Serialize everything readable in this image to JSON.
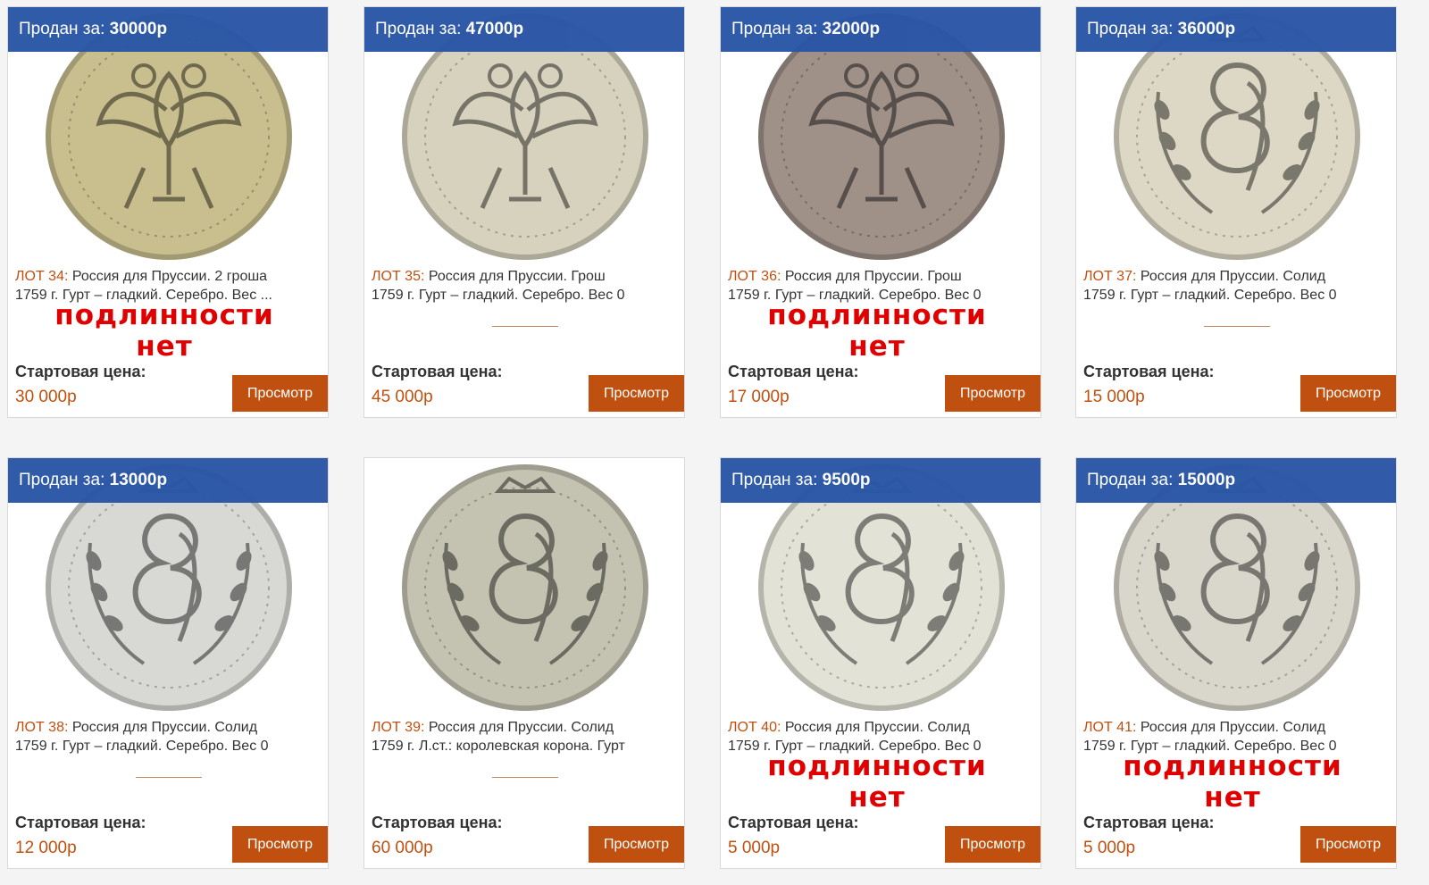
{
  "common": {
    "sold_prefix": "Продан за: ",
    "start_label": "Стартовая цена:",
    "view_button": "Просмотр",
    "stamp_line1": "подлинности",
    "stamp_line2": "нет"
  },
  "lots": [
    {
      "sold": "30000р",
      "lot": "ЛОТ 34:",
      "title": "Россия для Пруссии. 2 гроша",
      "line2": "1759 г. Гурт – гладкий. Серебро. Вес ...",
      "price": "30 000р",
      "stamp": true,
      "coin": "eagle-coin-icon",
      "tone": "#c9bf8e"
    },
    {
      "sold": "47000р",
      "lot": "ЛОТ 35:",
      "title": "Россия для Пруссии. Грош",
      "line2": "1759 г. Гурт – гладкий. Серебро. Вес 0",
      "price": "45 000р",
      "stamp": false,
      "coin": "eagle-coin-icon",
      "tone": "#d6d2bd"
    },
    {
      "sold": "32000р",
      "lot": "ЛОТ 36:",
      "title": "Россия для Пруссии. Грош",
      "line2": "1759 г. Гурт – гладкий. Серебро. Вес 0",
      "price": "17 000р",
      "stamp": true,
      "coin": "eagle-coin-icon",
      "tone": "#9f9088"
    },
    {
      "sold": "36000р",
      "lot": "ЛОТ 37:",
      "title": "Россия для Пруссии. Солид",
      "line2": "1759 г. Гурт – гладкий. Серебро. Вес 0",
      "price": "15 000р",
      "stamp": false,
      "coin": "monogram-coin-icon",
      "tone": "#ddd8c6"
    },
    {
      "sold": "13000р",
      "lot": "ЛОТ 38:",
      "title": "Россия для Пруссии. Солид",
      "line2": "1759 г. Гурт – гладкий. Серебро. Вес 0",
      "price": "12 000р",
      "stamp": false,
      "coin": "monogram-coin-icon",
      "tone": "#d8d8d4"
    },
    {
      "sold": "",
      "lot": "ЛОТ 39:",
      "title": "Россия для Пруссии. Солид",
      "line2": "1759 г. Л.ст.: королевская корона. Гурт",
      "price": "60 000р",
      "stamp": false,
      "coin": "monogram-coin-icon",
      "tone": "#c4c3b2"
    },
    {
      "sold": "9500р",
      "lot": "ЛОТ 40:",
      "title": "Россия для Пруссии. Солид",
      "line2": "1759 г. Гурт – гладкий. Серебро. Вес 0",
      "price": "5 000р",
      "stamp": true,
      "coin": "monogram-coin-icon",
      "tone": "#e3e2d6"
    },
    {
      "sold": "15000р",
      "lot": "ЛОТ 41:",
      "title": "Россия для Пруссии. Солид",
      "line2": "1759 г. Гурт – гладкий. Серебро. Вес 0",
      "price": "5 000р",
      "stamp": true,
      "coin": "monogram-coin-icon",
      "tone": "#d9d6cb"
    }
  ]
}
